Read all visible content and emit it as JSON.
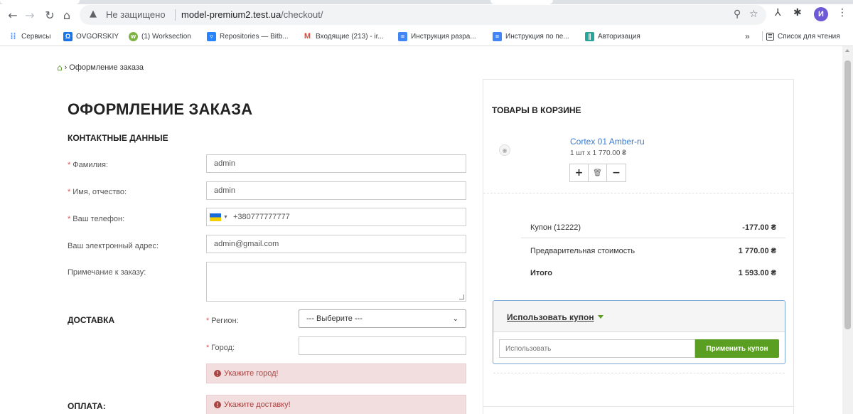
{
  "browser": {
    "address": {
      "security_label": "Не защищено",
      "host": "model-premium2.test.ua",
      "path": "/checkout/"
    },
    "profile_initial": "И",
    "bookmarks": [
      {
        "label": "Сервисы",
        "color": "#4285f4"
      },
      {
        "label": "OVGORSKIY",
        "color": "#1a73e8"
      },
      {
        "label": "(1) Worksection",
        "color": "#7cb342"
      },
      {
        "label": "Repositories — Bitb...",
        "color": "#2684ff"
      },
      {
        "label": "Входящие (213) - ir...",
        "color": "#ea4335"
      },
      {
        "label": "Инструкция разра...",
        "color": "#4285f4"
      },
      {
        "label": "Инструкция по пе...",
        "color": "#4285f4"
      },
      {
        "label": "Авторизация",
        "color": "#26a69a"
      }
    ],
    "bookmarks_more": "»",
    "reading_list": "Список для чтения"
  },
  "page": {
    "breadcrumb": {
      "current": "Оформление заказа"
    },
    "title": "ОФОРМЛЕНИЕ ЗАКАЗА",
    "contact": {
      "section_title": "КОНТАКТНЫЕ ДАННЫЕ",
      "fields": {
        "lastname": {
          "label": "Фамилия:",
          "value": "admin"
        },
        "firstname": {
          "label": "Имя, отчество:",
          "value": "admin"
        },
        "phone": {
          "label": "Ваш телефон:",
          "value": "+380777777777"
        },
        "email": {
          "label": "Ваш электронный адрес:",
          "value": "admin@gmail.com"
        },
        "comment": {
          "label": "Примечание к заказу:",
          "value": ""
        }
      }
    },
    "delivery": {
      "section_title": "ДОСТАВКА",
      "region_label": "Регион:",
      "region_value": "--- Выберите ---",
      "city_label": "Город:",
      "city_value": "",
      "city_error": "Укажите город!"
    },
    "payment": {
      "section_title": "ОПЛАТА:",
      "error": "Укажите доставку!"
    }
  },
  "cart": {
    "title": "ТОВАРЫ В КОРЗИНЕ",
    "item": {
      "name": "Cortex 01 Amber-ru",
      "qty_line": "1 шт x 1 770.00 ₴",
      "plus": "+",
      "minus": "−"
    },
    "totals": [
      {
        "label": "Купон (12222)",
        "value": "-177.00 ₴"
      },
      {
        "label": "Предварительная стоимость",
        "value": "1 770.00 ₴"
      },
      {
        "label": "Итого",
        "value": "1 593.00 ₴"
      }
    ],
    "coupon": {
      "toggle_label": "Использовать купон",
      "placeholder": "Использовать",
      "apply_label": "Применить купон"
    }
  }
}
